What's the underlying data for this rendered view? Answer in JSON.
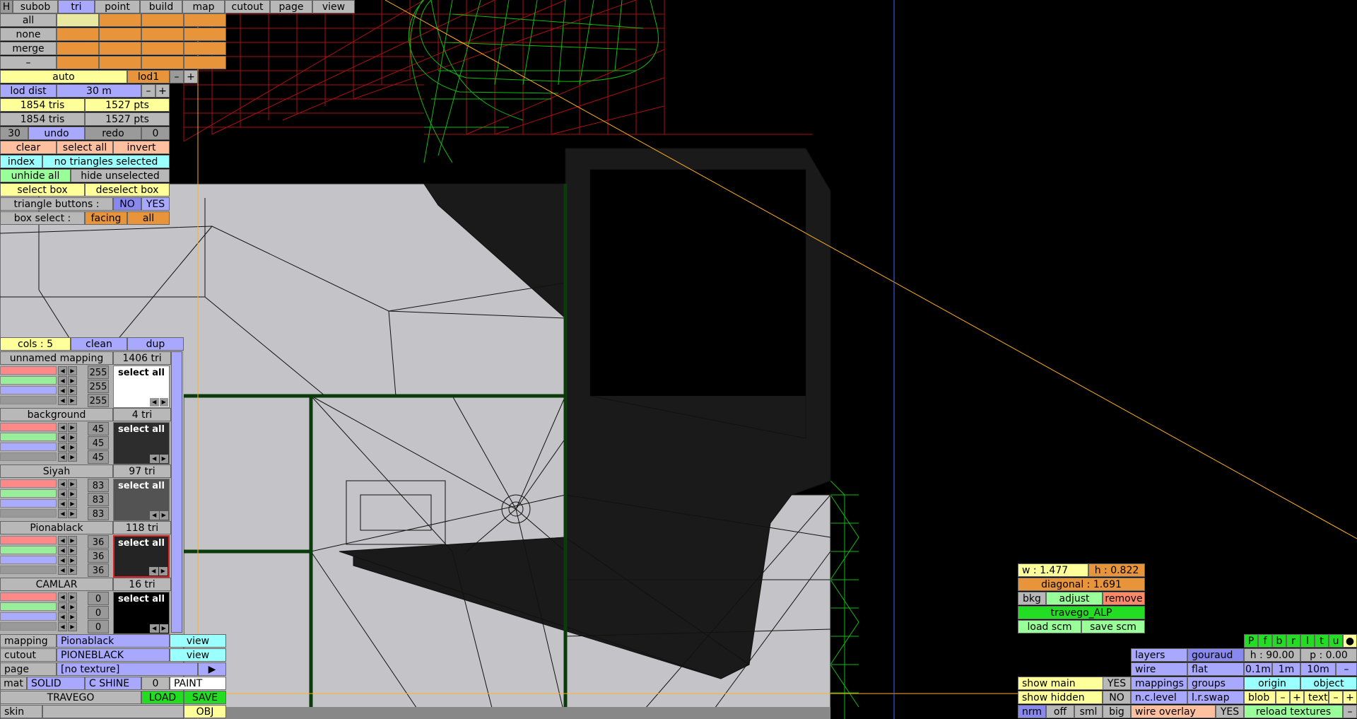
{
  "topbar": {
    "h_label": "H",
    "tabs": [
      "subob",
      "tri",
      "point",
      "build",
      "map",
      "cutout",
      "page",
      "view"
    ],
    "active_tab": "tri"
  },
  "sel_rows": [
    "all",
    "none",
    "merge",
    "–"
  ],
  "lod": {
    "auto": "auto",
    "lod1": "lod1",
    "minus": "–",
    "plus": "+",
    "dist_label": "lod dist",
    "dist_value": "30 m"
  },
  "stats": {
    "tris1": "1854 tris",
    "pts1": "1527 pts",
    "tris2": "1854 tris",
    "pts2": "1527 pts"
  },
  "undo": {
    "count": "30",
    "undo": "undo",
    "redo": "redo",
    "redo_count": "0"
  },
  "tri_actions": {
    "clear": "clear",
    "select_all": "select all",
    "invert": "invert",
    "index": "index",
    "status": "no triangles selected",
    "unhide_all": "unhide all",
    "hide_unselected": "hide unselected",
    "select_box": "select box",
    "deselect_box": "deselect box",
    "tri_buttons_label": "triangle buttons :",
    "no": "NO",
    "yes": "YES",
    "box_select_label": "box select :",
    "facing": "facing",
    "all": "all"
  },
  "cols": {
    "label": "cols : 5",
    "clean": "clean",
    "dup": "dup"
  },
  "materials": [
    {
      "name": "unnamed mapping",
      "tris": "1406 tri",
      "r": "255",
      "g": "255",
      "b": "255",
      "swatch": "#ffffff",
      "text": "#000000",
      "select": "select all"
    },
    {
      "name": "background",
      "tris": "4 tri",
      "r": "45",
      "g": "45",
      "b": "45",
      "swatch": "#2d2d2d",
      "text": "#ffffff",
      "select": "select all"
    },
    {
      "name": "Siyah",
      "tris": "97 tri",
      "r": "83",
      "g": "83",
      "b": "83",
      "swatch": "#535353",
      "text": "#ffffff",
      "select": "select all"
    },
    {
      "name": "Pionablack",
      "tris": "118 tri",
      "r": "36",
      "g": "36",
      "b": "36",
      "swatch": "#242424",
      "text": "#ffffff",
      "select": "select all"
    },
    {
      "name": "CAMLAR",
      "tris": "16 tri",
      "r": "0",
      "g": "0",
      "b": "0",
      "swatch": "#000000",
      "text": "#ffffff",
      "select": "select all"
    }
  ],
  "bottom_left": {
    "mapping_label": "mapping",
    "mapping_value": "Pionablack",
    "cutout_label": "cutout",
    "cutout_value": "PIONEBLACK",
    "view": "view",
    "page_label": "page",
    "page_value": "[no texture]",
    "mat": "mat",
    "solid": "SOLID",
    "cshine": "C SHINE",
    "zero": "0",
    "paint": "PAINT",
    "model": "TRAVEGO",
    "load": "LOAD",
    "save": "SAVE",
    "skin": "skin",
    "obj": "OBJ"
  },
  "bottom_right": {
    "show_main": "show main",
    "show_main_val": "YES",
    "show_hidden": "show hidden",
    "show_hidden_val": "NO",
    "nrm": "nrm",
    "off": "off",
    "sml": "sml",
    "big": "big",
    "layers": "layers",
    "gouraud": "gouraud",
    "wire": "wire",
    "flat": "flat",
    "mappings": "mappings",
    "groups": "groups",
    "nclevel": "n.c.level",
    "lrswap": "l.r.swap",
    "wire_overlay": "wire overlay",
    "wire_overlay_val": "YES",
    "w": "w : 1.477",
    "h": "h : 0.822",
    "diagonal": "diagonal : 1.691",
    "bkg": "bkg",
    "adjust": "adjust",
    "remove": "remove",
    "name": "travego_ALP",
    "load_scm": "load scm",
    "save_scm": "save scm",
    "views": [
      "P",
      "f",
      "b",
      "r",
      "l",
      "t",
      "u",
      "●"
    ],
    "hval": "h : 90.00",
    "pval": "p : 0.00",
    "g01": "0.1m",
    "g1": "1m",
    "g10": "10m",
    "gminus": "–",
    "origin": "origin",
    "object": "object",
    "blob": "blob",
    "minus": "–",
    "plus": "+",
    "text": "text",
    "reload": "reload textures"
  }
}
